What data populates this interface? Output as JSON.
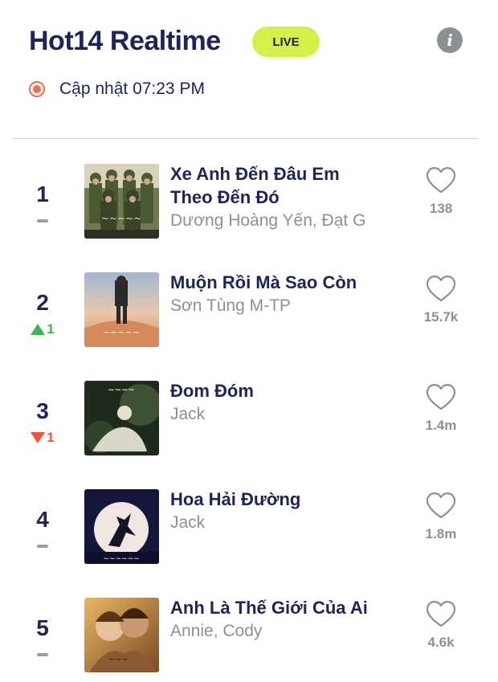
{
  "header": {
    "title": "Hot14 Realtime",
    "live_badge": "LIVE",
    "info_icon": "info-icon"
  },
  "status": {
    "updated_label": "Cập nhật 07:23 PM",
    "icon": "record-icon"
  },
  "colors": {
    "title": "#1e2457",
    "live_bg": "#d6f04a",
    "up": "#3fb25b",
    "down": "#f2533a",
    "muted": "#8d8f96"
  },
  "songs": [
    {
      "rank": "1",
      "change": "same",
      "change_value": "",
      "title_line1": "Xe Anh Đến Đâu Em",
      "title_line2": "Theo Đến Đó",
      "artist": "Dương Hoàng Yến, Đạt G",
      "likes": "138"
    },
    {
      "rank": "2",
      "change": "up",
      "change_value": "1",
      "title_line1": "Muộn Rồi Mà Sao Còn",
      "title_line2": "",
      "artist": "Sơn Tùng M-TP",
      "likes": "15.7k"
    },
    {
      "rank": "3",
      "change": "down",
      "change_value": "1",
      "title_line1": "Đom Đóm",
      "title_line2": "",
      "artist": "Jack",
      "likes": "1.4m"
    },
    {
      "rank": "4",
      "change": "same",
      "change_value": "",
      "title_line1": "Hoa Hải Đường",
      "title_line2": "",
      "artist": "Jack",
      "likes": "1.8m"
    },
    {
      "rank": "5",
      "change": "same",
      "change_value": "",
      "title_line1": "Anh Là Thế Giới Của Ai",
      "title_line2": "",
      "artist": "Annie, Cody",
      "likes": "4.6k"
    }
  ]
}
